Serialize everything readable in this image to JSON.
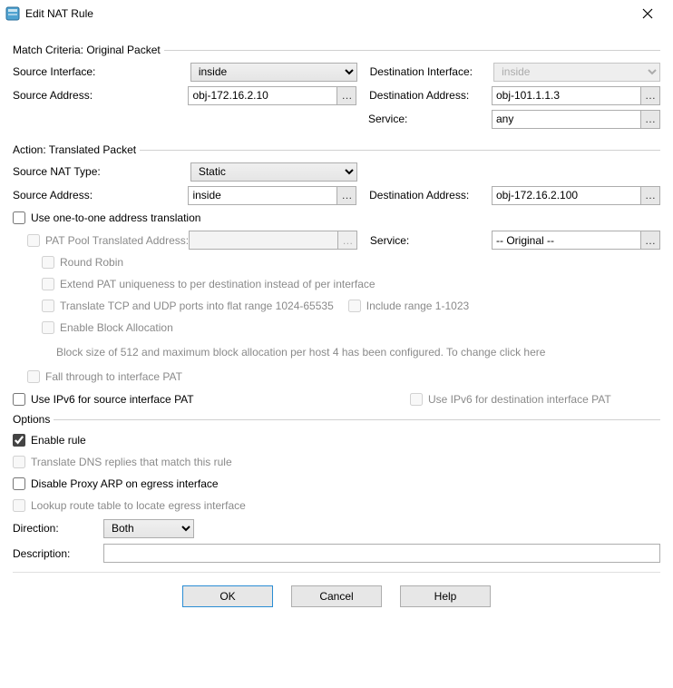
{
  "window": {
    "title": "Edit NAT Rule"
  },
  "groups": {
    "match": "Match Criteria: Original Packet",
    "action": "Action: Translated Packet",
    "options": "Options"
  },
  "labels": {
    "source_interface": "Source Interface:",
    "destination_interface": "Destination Interface:",
    "source_address": "Source Address:",
    "destination_address": "Destination Address:",
    "service": "Service:",
    "source_nat_type": "Source NAT Type:",
    "pat_pool": "PAT Pool Translated Address:",
    "round_robin": "Round Robin",
    "extend_pat": "Extend PAT uniqueness to per destination instead of per interface",
    "flat_range": "Translate TCP and UDP ports into flat range 1024-65535",
    "include_range": "Include range 1-1023",
    "enable_block": "Enable Block Allocation",
    "block_note": "Block size of 512 and maximum block allocation per host 4 has been configured. To change click here",
    "fall_through": "Fall through to interface PAT",
    "ipv6_src": "Use IPv6 for source interface PAT",
    "ipv6_dst": "Use IPv6 for destination interface PAT",
    "use_one_to_one": "Use one-to-one address translation",
    "enable_rule": "Enable rule",
    "translate_dns": "Translate DNS replies that match this rule",
    "disable_proxy_arp": "Disable Proxy ARP on egress interface",
    "lookup_route": "Lookup route table to locate egress interface",
    "direction": "Direction:",
    "description": "Description:"
  },
  "values": {
    "match": {
      "source_interface": "inside",
      "destination_interface": "inside",
      "source_address": "obj-172.16.2.10",
      "destination_address": "obj-101.1.1.3",
      "service": "any"
    },
    "action": {
      "source_nat_type": "Static",
      "source_address": "inside",
      "destination_address": "obj-172.16.2.100",
      "pat_pool": "",
      "service": "-- Original --"
    },
    "options": {
      "direction": "Both",
      "description": ""
    }
  },
  "buttons": {
    "ok": "OK",
    "cancel": "Cancel",
    "help": "Help"
  }
}
